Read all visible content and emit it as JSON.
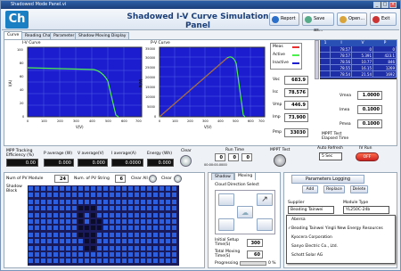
{
  "window": {
    "title": "Shadowed Mode Panel.vi"
  },
  "header": {
    "logo": "Ch",
    "title": "Shadowed I-V Curve Simulation Panel",
    "buttons": [
      "Report",
      "Save as...",
      "Open...",
      "Exit"
    ]
  },
  "tabs": [
    "Curve",
    "Reading Chart",
    "Parameter",
    "Shadow Moving Display"
  ],
  "iv_chart": {
    "title": "I-V Curve",
    "ylabel": "I(A)",
    "xlabel": "V(V)",
    "yticks": [
      "0",
      "20",
      "40",
      "60",
      "80",
      "100"
    ],
    "xticks": [
      "0",
      "100",
      "200",
      "300",
      "400",
      "500",
      "600",
      "700"
    ]
  },
  "pv_chart": {
    "title": "P-V Curve",
    "ylabel": "P(W)",
    "xlabel": "V(V)",
    "yticks": [
      "0",
      "5000",
      "10000",
      "15000",
      "20000",
      "25000",
      "30000",
      "35000"
    ],
    "xticks": [
      "0",
      "100",
      "200",
      "300",
      "400",
      "500",
      "600",
      "700"
    ]
  },
  "legend": [
    "Meas",
    "Active",
    "Inactive"
  ],
  "readouts": [
    {
      "label": "Voc",
      "value": "683.9"
    },
    {
      "label": "Isc",
      "value": "78.576"
    },
    {
      "label": "Vmp",
      "value": "446.9"
    },
    {
      "label": "Imp",
      "value": "73.900"
    },
    {
      "label": "Pmp",
      "value": "33030"
    }
  ],
  "table": {
    "headers": [
      "I",
      "V",
      "P"
    ],
    "rows": [
      [
        "78.57",
        "0",
        "0"
      ],
      [
        "78.57",
        "5.391",
        "423.1"
      ],
      [
        "78.56",
        "10.77",
        "846"
      ],
      [
        "78.55",
        "16.15",
        "1269"
      ],
      [
        "78.54",
        "21.54",
        "1692"
      ]
    ]
  },
  "meas": {
    "vmea_label": "Vmea",
    "vmea": "1.0000",
    "imea_label": "Imea",
    "imea": "0.1000",
    "pmea_label": "Pmea",
    "pmea": "0.1000"
  },
  "mppt": {
    "label": "MPPT Test Elapsed Time",
    "auto_refresh": "Auto Refresh",
    "auto_value": "5 Sec",
    "ivrun": "IV Run",
    "ivrun_state": "OFF"
  },
  "tracking": {
    "label": "MPP Tracking Efficiency (%)",
    "efficiency": "0.00",
    "cols": [
      {
        "label": "P average (W)",
        "value": "0.000"
      },
      {
        "label": "V average(V)",
        "value": "0.000"
      },
      {
        "label": "I average(A)",
        "value": "0.0000"
      },
      {
        "label": "Energy (Wh)",
        "value": "0.000"
      }
    ],
    "clear": "Clear",
    "run_time": "Run Time",
    "mppt_test": "MPPT Test",
    "time_h": "0",
    "time_m": "0",
    "time_s": "0",
    "stamp": "00:00:00.0000"
  },
  "shadow": {
    "num_module_label": "Num of PV Module",
    "num_module": "24",
    "num_string_label": "Num. of PV String",
    "num_string": "6",
    "clear_all": "Clear All",
    "clear": "Clear",
    "block_label": "Shadow Block"
  },
  "moving": {
    "tabs": [
      "Shadow",
      "Moving"
    ],
    "cloud_label": "Cloud Direction Select",
    "init_label": "Initial Setup Time(S)",
    "init_val": "300",
    "total_label": "Total Moving Time(S)",
    "total_val": "60",
    "progress_label": "Progressing",
    "progress_val": "0 %"
  },
  "params": {
    "title": "Parameters Logging",
    "buttons": [
      "Add",
      "Replace",
      "Delete"
    ],
    "supplier_label": "Supplier",
    "supplier": "Beading Tainwei",
    "module_label": "Module Type",
    "module": "YL250C-24b",
    "list": [
      "Abersa",
      "Beading Tainwei Yingli New Energy Resources",
      "Kyocera Corporation",
      "Sanyo Electric Co., Ltd.",
      "Schott Solar AG"
    ]
  }
}
